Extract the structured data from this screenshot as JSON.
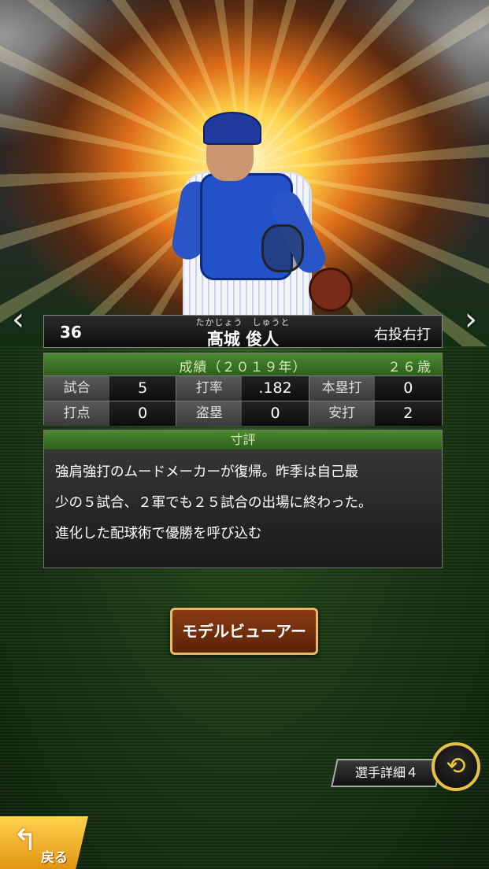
{
  "player": {
    "number": "36",
    "name_ruby": "たかじょう　しゅうと",
    "name": "髙城 俊人",
    "handedness": "右投右打"
  },
  "stats": {
    "title": "成績（２０１９年）",
    "age": "２６歳",
    "rows": [
      {
        "label": "試合",
        "value": "5"
      },
      {
        "label": "打率",
        "value": ".182"
      },
      {
        "label": "本塁打",
        "value": "0"
      },
      {
        "label": "打点",
        "value": "0"
      },
      {
        "label": "盗塁",
        "value": "0"
      },
      {
        "label": "安打",
        "value": "2"
      }
    ]
  },
  "review": {
    "title": "寸評",
    "lines": [
      "強肩強打のムードメーカーが復帰。昨季は自己最",
      "少の５試合、２軍でも２５試合の出場に終わった。",
      "進化した配球術で優勝を呼び込む"
    ]
  },
  "buttons": {
    "model_viewer": "モデルビューアー",
    "player_detail": "選手詳細４",
    "back": "戻る"
  },
  "icons": {
    "nav_left": "‹",
    "nav_right": "›",
    "swap": "⟲",
    "back_arrow": "↰"
  },
  "colors": {
    "accent_green": "#2c5f1c",
    "button_brown": "#5a2308",
    "gold": "#e6c24a"
  }
}
